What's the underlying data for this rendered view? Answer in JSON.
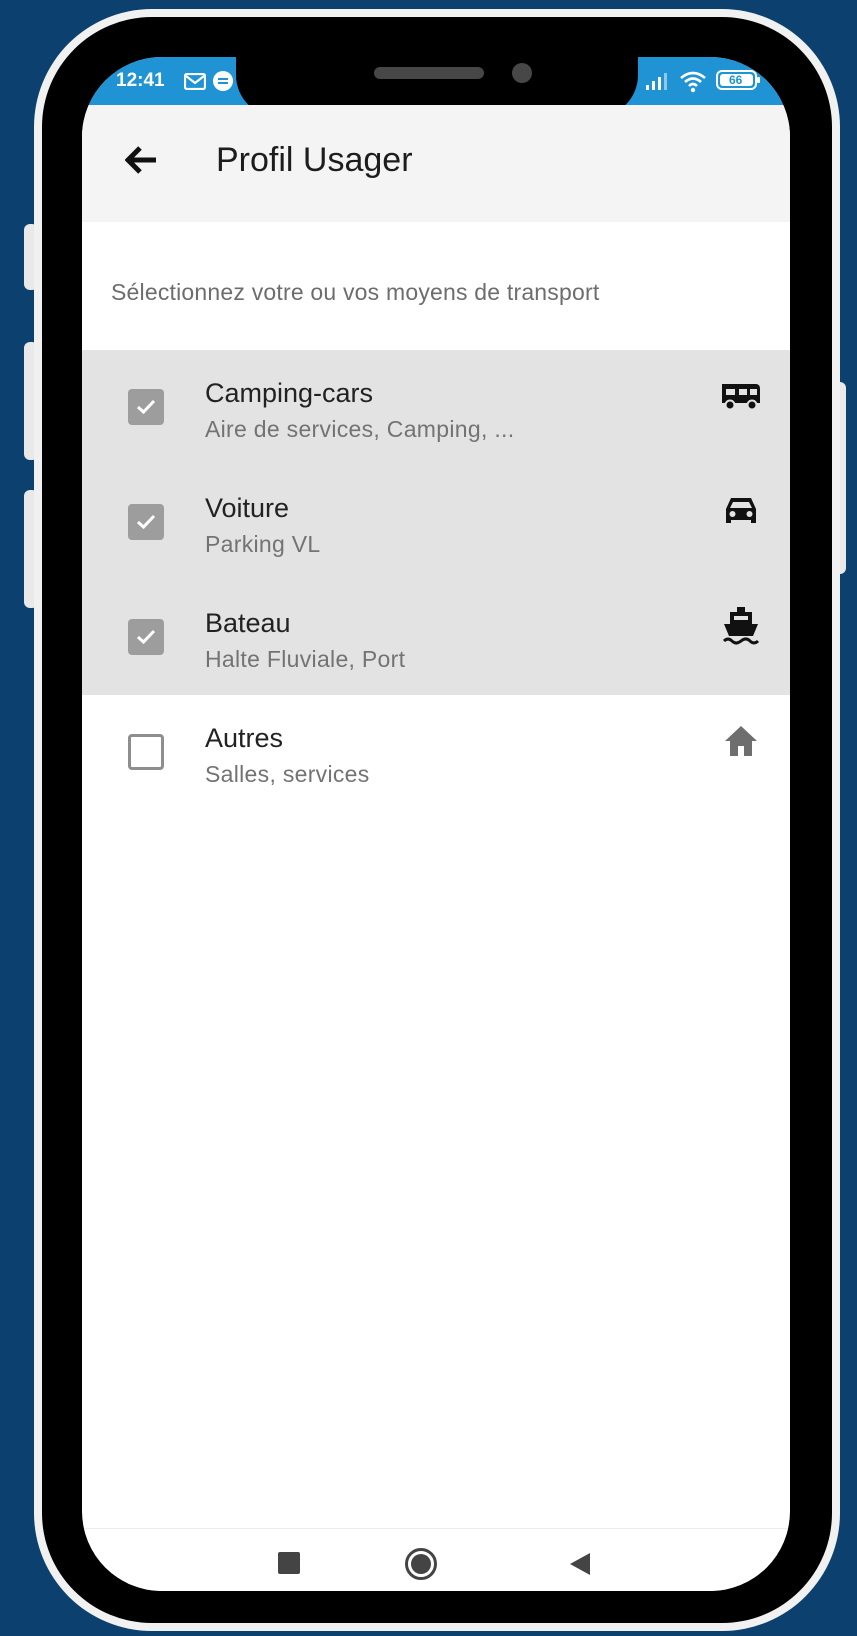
{
  "status_bar": {
    "time": "12:41",
    "battery": "66"
  },
  "app_bar": {
    "title": "Profil Usager"
  },
  "instruction": "Sélectionnez votre ou vos moyens de transport",
  "transport_options": [
    {
      "title": "Camping-cars",
      "subtitle": "Aire de services, Camping, ...",
      "checked": true,
      "icon": "camper-icon"
    },
    {
      "title": "Voiture",
      "subtitle": "Parking VL",
      "checked": true,
      "icon": "car-icon"
    },
    {
      "title": "Bateau",
      "subtitle": "Halte Fluviale, Port",
      "checked": true,
      "icon": "boat-icon"
    },
    {
      "title": "Autres",
      "subtitle": "Salles, services",
      "checked": false,
      "icon": "home-icon"
    }
  ],
  "nav": [
    "recents-button",
    "home-button",
    "back-nav-button"
  ],
  "colors": {
    "background": "#0c416f",
    "status_bar": "#1f93d3",
    "checked_row": "#e3e3e3",
    "checkbox_checked": "#9d9d9d"
  }
}
